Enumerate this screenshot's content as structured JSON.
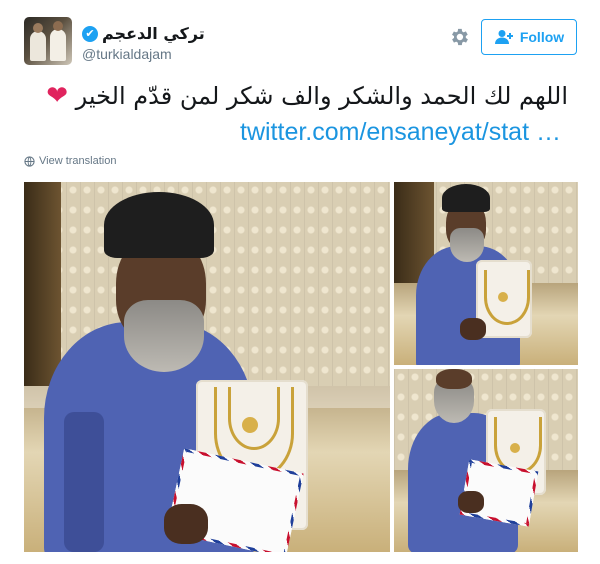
{
  "user": {
    "display_name": "تركي الدعجم",
    "handle": "@turkialdajam",
    "verified_mark": "✔"
  },
  "actions": {
    "follow_label": "Follow",
    "settings_icon": "gear-icon",
    "follow_icon": "add-person-icon"
  },
  "tweet": {
    "text": "اللهم لك الحمد والشكر والف شكر لمن قدّم الخير",
    "emoji": "❤",
    "link": "twitter.com/ensaneyat/stat …",
    "view_translation": "View translation"
  },
  "colors": {
    "accent": "#1da1f2",
    "link": "#1b95e0",
    "heart": "#e0245e",
    "muted": "#657786"
  }
}
